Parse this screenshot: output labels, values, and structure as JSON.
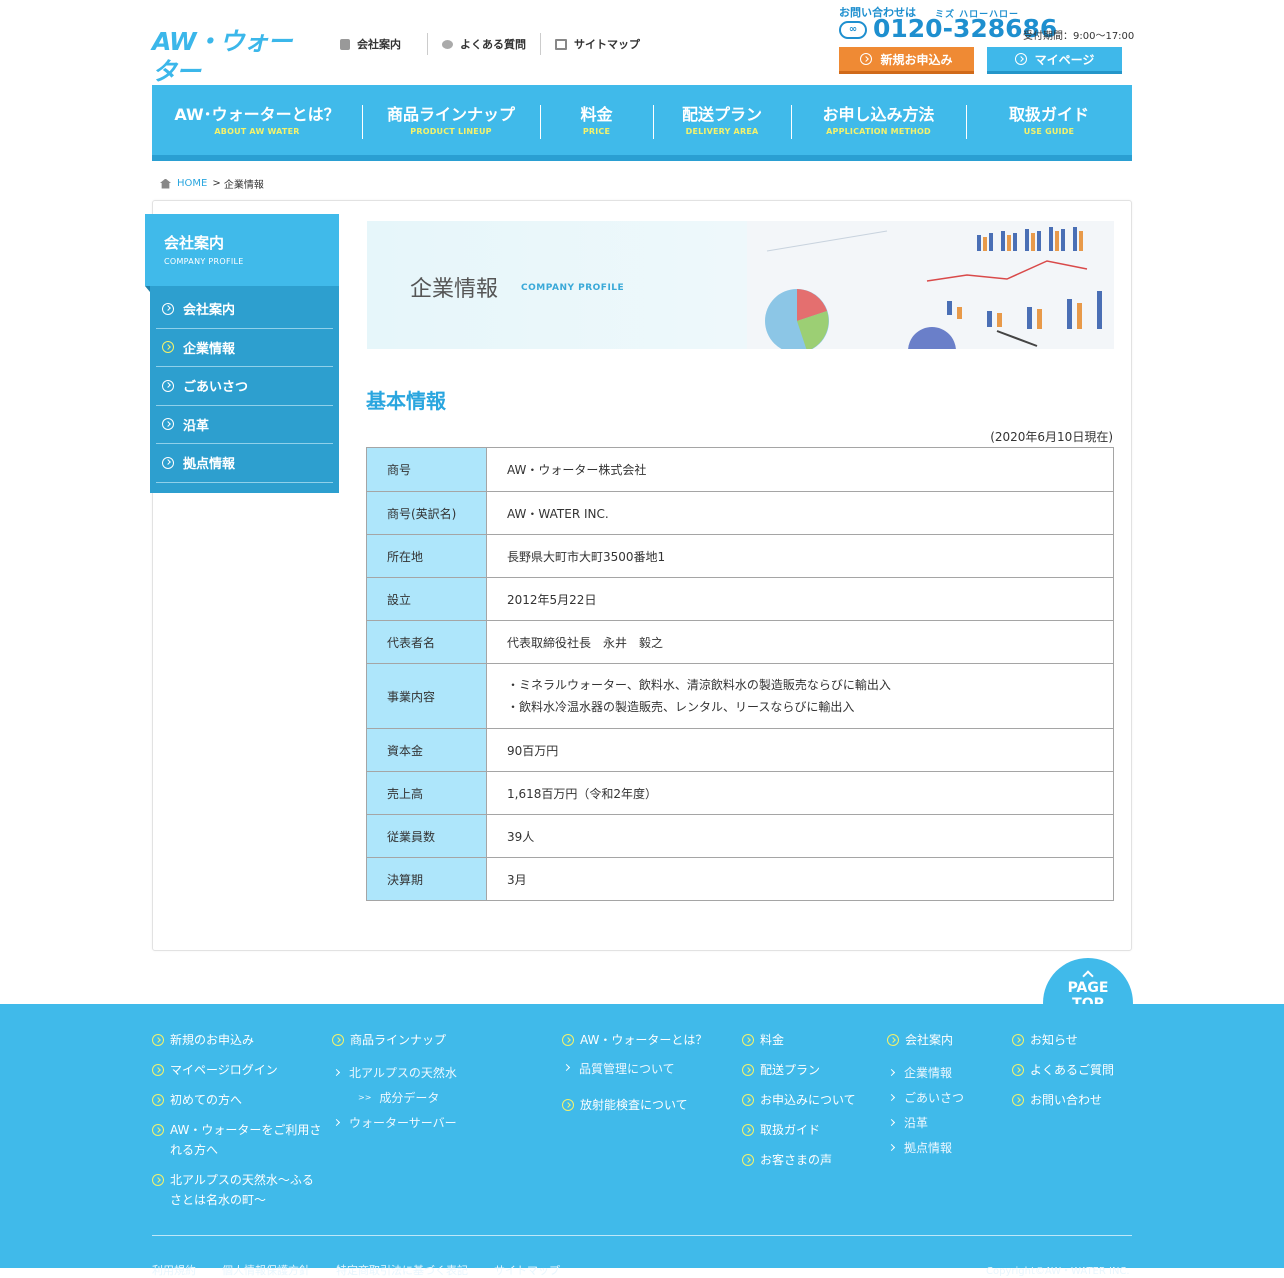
{
  "header": {
    "logo": "AW・ウォーター",
    "util_links": [
      "会社案内",
      "よくある質問",
      "サイトマップ"
    ],
    "phone": {
      "ask": "お問い合わせは",
      "reading": "ミズ ハローハロー",
      "number": "0120-328686",
      "hours": "受付期間：9:00〜17:00"
    },
    "apply_label": "新規お申込み",
    "mypage_label": "マイページ"
  },
  "gnav": [
    {
      "jp": "AW･ウォーターとは？",
      "en": "ABOUT AW WATER"
    },
    {
      "jp": "商品ラインナップ",
      "en": "PRODUCT LINEUP"
    },
    {
      "jp": "料金",
      "en": "PRICE"
    },
    {
      "jp": "配送プラン",
      "en": "DELIVERY AREA"
    },
    {
      "jp": "お申し込み方法",
      "en": "APPLICATION METHOD"
    },
    {
      "jp": "取扱ガイド",
      "en": "USE GUIDE"
    }
  ],
  "breadcrumb": {
    "home": "HOME",
    "sep": ">",
    "current": "企業情報"
  },
  "side": {
    "title": "会社案内",
    "subtitle": "COMPANY PROFILE",
    "items": [
      "会社案内",
      "企業情報",
      "ごあいさつ",
      "沿革",
      "拠点情報"
    ]
  },
  "banner": {
    "title": "企業情報",
    "subtitle": "COMPANY PROFILE"
  },
  "section_title": "基本情報",
  "as_of": "(2020年6月10日現在)",
  "info": [
    {
      "k": "商号",
      "v": "AW・ウォーター株式会社"
    },
    {
      "k": "商号(英訳名)",
      "v": "AW・WATER INC."
    },
    {
      "k": "所在地",
      "v": "長野県大町市大町3500番地1"
    },
    {
      "k": "設立",
      "v": "2012年5月22日"
    },
    {
      "k": "代表者名",
      "v": "代表取締役社長　永井　毅之"
    },
    {
      "k": "事業内容",
      "v1": "・ミネラルウォーター、飲料水、清涼飲料水の製造販売ならびに輸出入",
      "v2": "・飲料水冷温水器の製造販売、レンタル、リースならびに輸出入"
    },
    {
      "k": "資本金",
      "v": "90百万円"
    },
    {
      "k": "売上高",
      "v": "1,618百万円（令和2年度）"
    },
    {
      "k": "従業員数",
      "v": "39人"
    },
    {
      "k": "決算期",
      "v": "3月"
    }
  ],
  "pagetop": {
    "l1": "PAGE",
    "l2": "TOP"
  },
  "footer": {
    "col1": [
      "新規のお申込み",
      "マイページログイン",
      "初めての方へ",
      "AW・ウォーターをご利用される方へ",
      "北アルプスの天然水〜ふるさとは名水の町〜"
    ],
    "col2_main": "商品ラインナップ",
    "col2_sub": [
      "北アルプスの天然水",
      "成分データ",
      "ウォーターサーバー"
    ],
    "col3_main": "AW・ウォーターとは？",
    "col3_sub": "品質管理について",
    "col3_main2": "放射能検査について",
    "col4": [
      "料金",
      "配送プラン",
      "お申込みについて",
      "取扱ガイド",
      "お客さまの声"
    ],
    "col5_main": "会社案内",
    "col5_sub": [
      "企業情報",
      "ごあいさつ",
      "沿革",
      "拠点情報"
    ],
    "col6": [
      "お知らせ",
      "よくあるご質問",
      "お問い合わせ"
    ],
    "bottom_links": [
      "利用規約",
      "個人情報保護方針",
      "特定商取引法に基づく表記",
      "サイトマップ"
    ],
    "copyright": "Copyright©AW・WATER INC."
  },
  "colors": {
    "brand": "#40baea",
    "accent_orange": "#ef8a34",
    "table_key_bg": "#aee6fb",
    "yellow": "#f4f26b"
  }
}
